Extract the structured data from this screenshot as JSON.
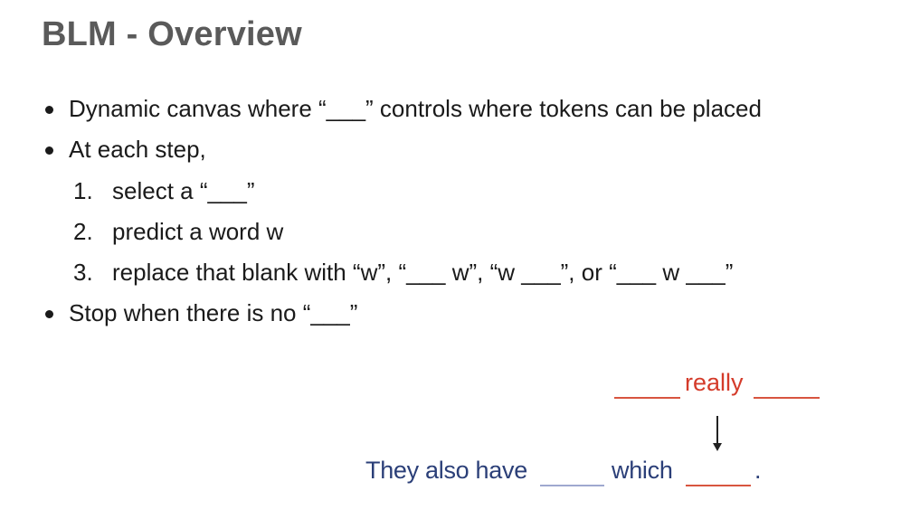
{
  "slide": {
    "title": "BLM - Overview",
    "bullets": [
      "Dynamic canvas where “___” controls where tokens can be placed",
      "At each step,",
      "Stop when there is no “___”"
    ],
    "steps": [
      {
        "num": "1.",
        "text": "select a “___”"
      },
      {
        "num": "2.",
        "text": "predict a word w"
      },
      {
        "num": "3.",
        "text": "replace that blank with “w”, “___ w”, “w ___”, or “___ w ___”"
      }
    ]
  },
  "diagram": {
    "inserted_word": "really",
    "sentence_part1": "They also have",
    "sentence_part2": "which",
    "sentence_end": ".",
    "colors": {
      "red": "#d43b2a",
      "blue": "#2b3f78",
      "blue_blank": "#9fa8cf"
    }
  }
}
